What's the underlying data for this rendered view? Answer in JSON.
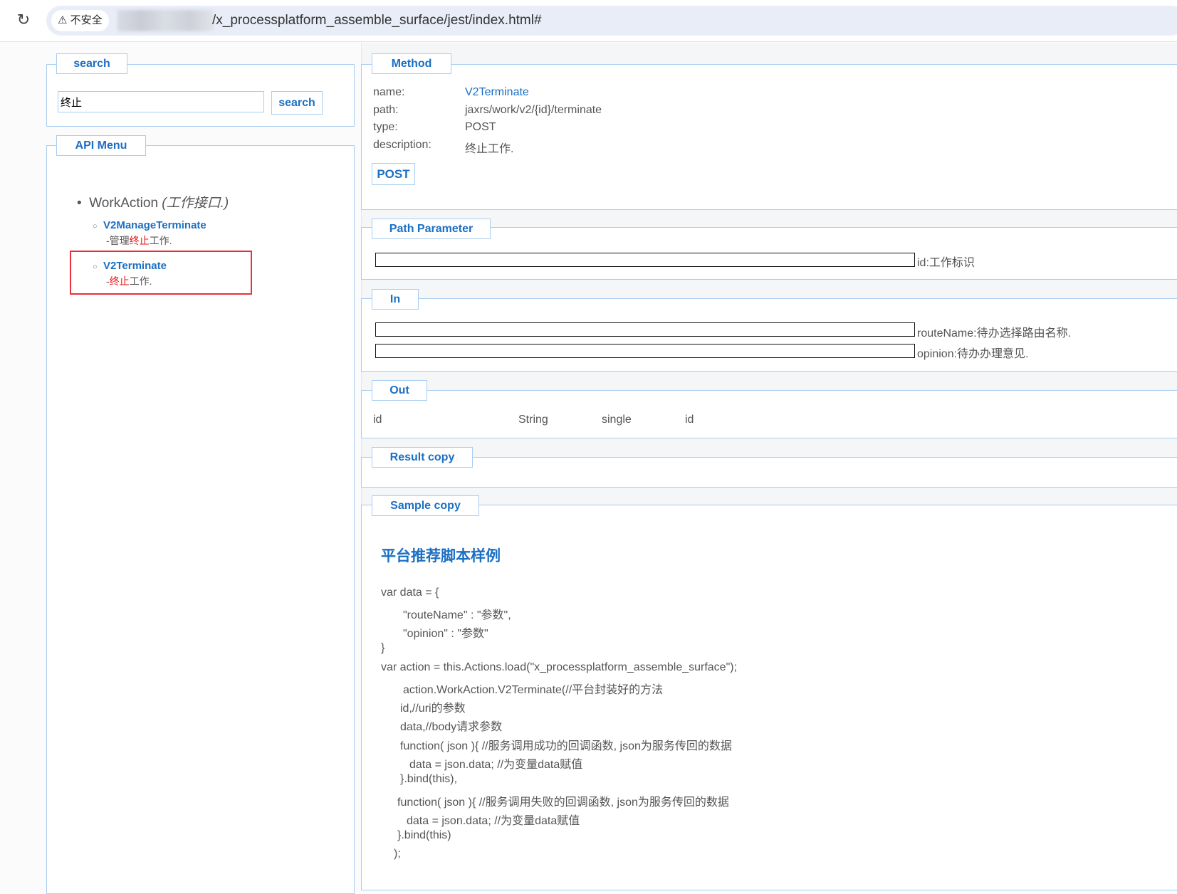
{
  "browser": {
    "security_label": "不安全",
    "url": "/x_processplatform_assemble_surface/jest/index.html#"
  },
  "search_panel": {
    "legend": "search",
    "input_value": "终止",
    "button_label": "search"
  },
  "api_menu": {
    "legend": "API Menu",
    "group_name": "WorkAction",
    "group_desc": "(工作接口.)",
    "items": [
      {
        "name": "V2ManageTerminate",
        "desc_prefix": "-管理",
        "desc_highlight": "终止",
        "desc_suffix": "工作."
      },
      {
        "name": "V2Terminate",
        "desc_prefix": "-",
        "desc_highlight": "终止",
        "desc_suffix": "工作."
      }
    ]
  },
  "method": {
    "legend": "Method",
    "rows": [
      {
        "label": "name:",
        "value": "V2Terminate"
      },
      {
        "label": "path:",
        "value": "jaxrs/work/v2/{id}/terminate"
      },
      {
        "label": "type:",
        "value": "POST"
      },
      {
        "label": "description:",
        "value": "终止工作."
      }
    ],
    "submit_label": "POST"
  },
  "path_parameter": {
    "legend": "Path Parameter",
    "params": [
      {
        "value": "",
        "desc": "id:工作标识"
      }
    ]
  },
  "in": {
    "legend": "In",
    "params": [
      {
        "value": "",
        "desc": "routeName:待办选择路由名称."
      },
      {
        "value": "",
        "desc": "opinion:待办办理意见."
      }
    ]
  },
  "out": {
    "legend": "Out",
    "row": {
      "name": "id",
      "type": "String",
      "mode": "single",
      "desc": "id"
    }
  },
  "result": {
    "legend": "Result copy"
  },
  "sample": {
    "legend": "Sample copy",
    "heading": "平台推荐脚本样例",
    "lines": [
      "var data = {",
      "\"routeName\" : \"参数\",",
      "\"opinion\" : \"参数\"",
      "}",
      "var action = this.Actions.load(\"x_processplatform_assemble_surface\");",
      "action.WorkAction.V2Terminate(//平台封装好的方法",
      "id,//uri的参数",
      "data,//body请求参数",
      "function( json ){ //服务调用成功的回调函数, json为服务传回的数据",
      "data = json.data; //为变量data赋值",
      "}.bind(this),",
      "function( json ){ //服务调用失败的回调函数, json为服务传回的数据",
      "data = json.data; //为变量data赋值",
      "}.bind(this)",
      ");"
    ]
  }
}
